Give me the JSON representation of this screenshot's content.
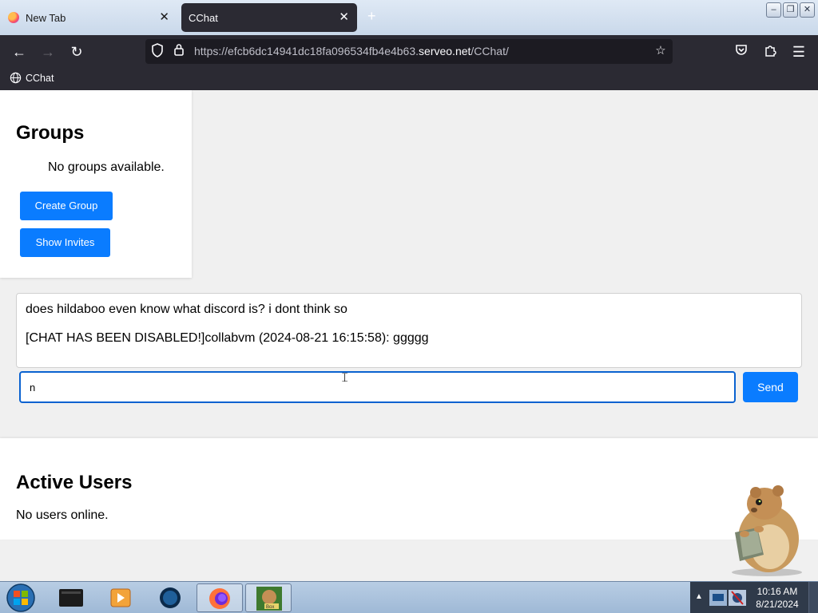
{
  "browser": {
    "tabs": [
      {
        "label": "New Tab",
        "active": false
      },
      {
        "label": "CChat",
        "active": true
      }
    ],
    "close_glyph": "✕",
    "new_tab_glyph": "+",
    "url": {
      "prefix": "https://efcb6dc14941dc18fa096534fb4e4b63.",
      "host": "serveo.net",
      "path": "/CChat/"
    },
    "bookmark": "CChat",
    "window_buttons": [
      "minimize-icon",
      "restore-icon",
      "close-icon"
    ]
  },
  "groups": {
    "title": "Groups",
    "empty_text": "No groups available.",
    "create_label": "Create Group",
    "invites_label": "Show Invites"
  },
  "chat": {
    "messages": [
      "does hildaboo even know what discord is? i dont think so",
      "[CHAT HAS BEEN DISABLED!]collabvm (2024-08-21 16:15:58): ggggg"
    ],
    "input_value": "n",
    "send_label": "Send"
  },
  "users": {
    "title": "Active Users",
    "empty_text": "No users online."
  },
  "taskbar": {
    "time": "10:16 AM",
    "date": "8/21/2024"
  },
  "colors": {
    "accent": "#0a7cff",
    "browser_chrome": "#2b2a33",
    "page_bg": "#f0f0f0"
  }
}
